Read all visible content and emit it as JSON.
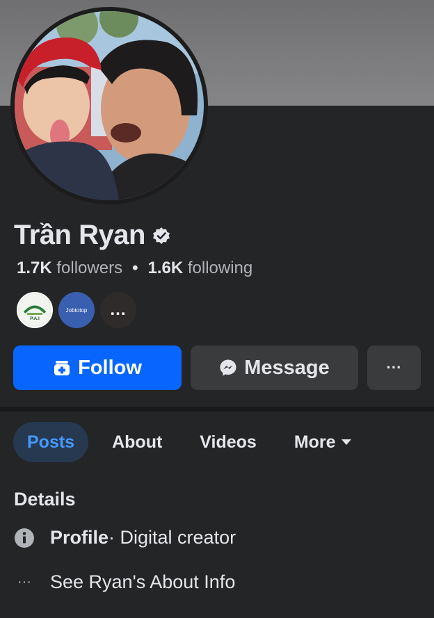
{
  "profile": {
    "name": "Trần Ryan",
    "verified": true,
    "followers_count": "1.7K",
    "followers_label": "followers",
    "separator": "•",
    "following_count": "1.6K",
    "following_label": "following"
  },
  "mutuals": [
    {
      "name": "pai-page-avatar",
      "text": "P.A.I"
    },
    {
      "name": "jobtotop-page-avatar",
      "text": "Jobtotop"
    },
    {
      "name": "more-mutuals",
      "text": "..."
    }
  ],
  "actions": {
    "follow_label": "Follow",
    "message_label": "Message",
    "more_label": "···"
  },
  "tabs": [
    {
      "label": "Posts",
      "active": true
    },
    {
      "label": "About",
      "active": false
    },
    {
      "label": "Videos",
      "active": false
    },
    {
      "label": "More",
      "active": false
    }
  ],
  "details": {
    "title": "Details",
    "profile_label": "Profile",
    "profile_value": " · Digital creator",
    "about_link_icon": "···",
    "about_link": "See Ryan's About Info"
  },
  "colors": {
    "background": "#242526",
    "primary_button": "#0866ff",
    "secondary_button": "#3a3b3c",
    "active_tab_bg": "#263951",
    "active_tab_text": "#4599ff",
    "muted_text": "#b0b3b8"
  },
  "icons": {
    "verified": "verified-badge-icon",
    "follow": "add-friend-icon",
    "message": "messenger-icon",
    "info": "info-icon",
    "more": "ellipsis-icon"
  }
}
